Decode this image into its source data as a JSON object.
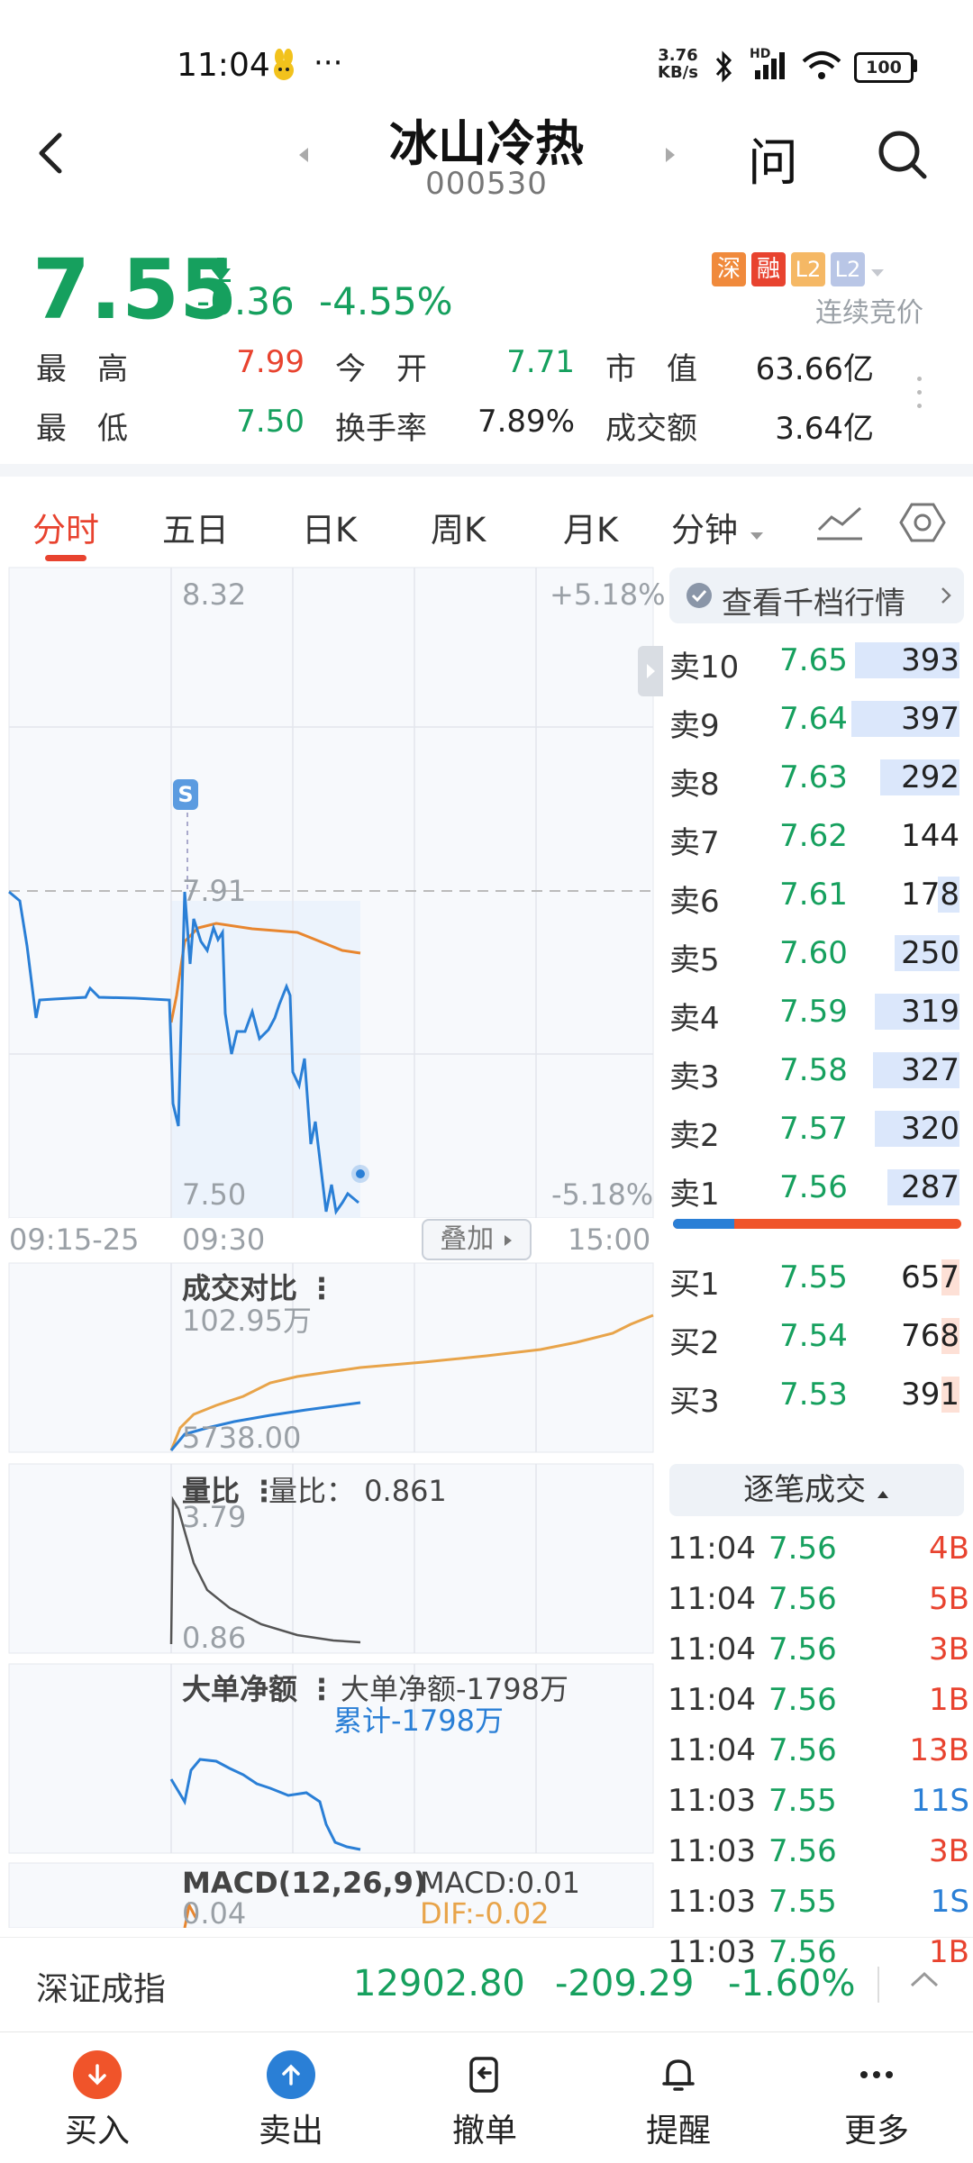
{
  "status_bar": {
    "time": "11:04",
    "dots": "···",
    "net_speed_top": "3.76",
    "net_speed_bottom": "KB/s",
    "hd": "HD",
    "battery": "100"
  },
  "header": {
    "title": "冰山冷热",
    "code": "000530",
    "ask_label": "问"
  },
  "quote": {
    "price": "7.55",
    "change": "-0.36",
    "change_pct": "-4.55%",
    "tags": [
      "深",
      "融",
      "L2",
      "L2"
    ],
    "auction_label": "连续竞价",
    "rows": [
      [
        {
          "label": "最　高",
          "value": "7.99",
          "color": "red"
        },
        {
          "label": "今　开",
          "value": "7.71",
          "color": "green"
        },
        {
          "label": "市　值",
          "value": "63.66亿",
          "color": "dark"
        }
      ],
      [
        {
          "label": "最　低",
          "value": "7.50",
          "color": "green"
        },
        {
          "label": "换手率",
          "value": "7.89%",
          "color": "dark"
        },
        {
          "label": "成交额",
          "value": "3.64亿",
          "color": "dark"
        }
      ]
    ]
  },
  "tabs": [
    "分时",
    "五日",
    "日K",
    "周K",
    "月K",
    "分钟"
  ],
  "chart": {
    "price_top": "8.32",
    "pct_top": "+5.18%",
    "price_ref": "7.91",
    "price_bottom": "7.50",
    "pct_bottom": "-5.18%",
    "s_marker": "S",
    "time_start": "09:15-25",
    "time_open": "09:30",
    "overlay_btn": "叠加",
    "time_end": "15:00",
    "vol_compare_title": "成交对比",
    "vol_compare_top": "102.95万",
    "vol_compare_bottom": "5738.00",
    "ratio_title": "量比",
    "ratio_value_text": "量比：  0.861",
    "ratio_top": "3.79",
    "ratio_bottom": "0.86",
    "bigorder_title": "大单净额",
    "bigorder_value": "大单净额-1798万",
    "bigorder_cum": "累计-1798万",
    "macd_title": "MACD(12,26,9)",
    "macd_value": "MACD:0.01",
    "macd_top": "0.04",
    "dif_value": "DIF:-0.02"
  },
  "orderbook": {
    "header": "查看千档行情",
    "sells": [
      {
        "label": "卖10",
        "price": "7.65",
        "vol": "393",
        "ratio": 0.58
      },
      {
        "label": "卖9",
        "price": "7.64",
        "vol": "397",
        "ratio": 0.6
      },
      {
        "label": "卖8",
        "price": "7.63",
        "vol": "292",
        "ratio": 0.44
      },
      {
        "label": "卖7",
        "price": "7.62",
        "vol": "144",
        "ratio": 0
      },
      {
        "label": "卖6",
        "price": "7.61",
        "vol": "178",
        "ratio": 0.12
      },
      {
        "label": "卖5",
        "price": "7.60",
        "vol": "250",
        "ratio": 0.36
      },
      {
        "label": "卖4",
        "price": "7.59",
        "vol": "319",
        "ratio": 0.47
      },
      {
        "label": "卖3",
        "price": "7.58",
        "vol": "327",
        "ratio": 0.48
      },
      {
        "label": "卖2",
        "price": "7.57",
        "vol": "320",
        "ratio": 0.47
      },
      {
        "label": "卖1",
        "price": "7.56",
        "vol": "287",
        "ratio": 0.4
      }
    ],
    "buys": [
      {
        "label": "买1",
        "price": "7.55",
        "vol": "657"
      },
      {
        "label": "买2",
        "price": "7.54",
        "vol": "768"
      },
      {
        "label": "买3",
        "price": "7.53",
        "vol": "391"
      }
    ],
    "trades_header": "逐笔成交",
    "trades": [
      {
        "time": "11:04",
        "price": "7.56",
        "vol": "4B",
        "side": "B",
        "pc": "green"
      },
      {
        "time": "11:04",
        "price": "7.56",
        "vol": "5B",
        "side": "B",
        "pc": "green"
      },
      {
        "time": "11:04",
        "price": "7.56",
        "vol": "3B",
        "side": "B",
        "pc": "green"
      },
      {
        "time": "11:04",
        "price": "7.56",
        "vol": "1B",
        "side": "B",
        "pc": "green"
      },
      {
        "time": "11:04",
        "price": "7.56",
        "vol": "13B",
        "side": "B",
        "pc": "green"
      },
      {
        "time": "11:03",
        "price": "7.55",
        "vol": "11S",
        "side": "S",
        "pc": "green"
      },
      {
        "time": "11:03",
        "price": "7.56",
        "vol": "3B",
        "side": "B",
        "pc": "green"
      },
      {
        "time": "11:03",
        "price": "7.55",
        "vol": "1S",
        "side": "S",
        "pc": "green"
      },
      {
        "time": "11:03",
        "price": "7.56",
        "vol": "1B",
        "side": "B",
        "pc": "green"
      }
    ]
  },
  "index_bar": {
    "name": "深证成指",
    "value": "12902.80",
    "change": "-209.29",
    "pct": "-1.60%"
  },
  "bottom_nav": [
    {
      "label": "买入",
      "icon": "buy-icon"
    },
    {
      "label": "卖出",
      "icon": "sell-icon"
    },
    {
      "label": "撤单",
      "icon": "cancel-order-icon"
    },
    {
      "label": "提醒",
      "icon": "bell-icon"
    },
    {
      "label": "更多",
      "icon": "more-icon"
    }
  ],
  "colors": {
    "up": "#e8432f",
    "down": "#16a05e",
    "price_line": "#2a7fd6",
    "avg_line": "#e8862f",
    "accent": "#f0542a"
  }
}
